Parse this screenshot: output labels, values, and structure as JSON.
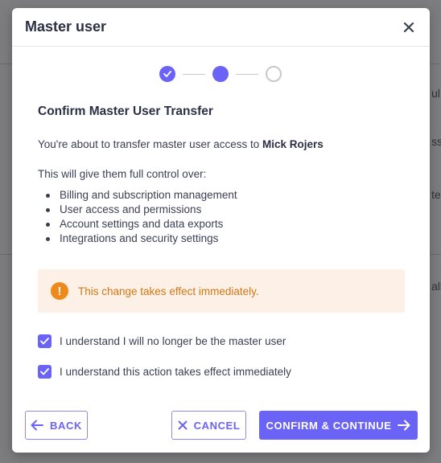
{
  "background": {
    "fragments": [
      "ul",
      "ss",
      "te",
      "all"
    ]
  },
  "modal": {
    "title": "Master user",
    "close_icon": "close-icon"
  },
  "stepper": {
    "steps": [
      {
        "state": "done"
      },
      {
        "state": "active"
      },
      {
        "state": "pending"
      }
    ]
  },
  "content": {
    "title": "Confirm Master User Transfer",
    "intro_prefix": "You're about to transfer master user access to",
    "recipient": "Mick Rojers",
    "control_intro": "This will give them full control over:",
    "bullets": [
      "Billing and subscription management",
      "User access and permissions",
      "Account settings and data exports",
      "Integrations and security settings"
    ],
    "warning": {
      "icon": "exclamation-icon",
      "text": "This change takes effect immediately."
    },
    "checkboxes": [
      {
        "label": "I understand I will no longer be the master user",
        "checked": true
      },
      {
        "label": "I understand this action takes effect immediately",
        "checked": true
      }
    ]
  },
  "footer": {
    "back_label": "BACK",
    "cancel_label": "CANCEL",
    "confirm_label": "CONFIRM & CONTINUE"
  },
  "colors": {
    "accent": "#6a63f6",
    "warning": "#ee8a1a",
    "warning_bg": "#fdf1e7"
  }
}
